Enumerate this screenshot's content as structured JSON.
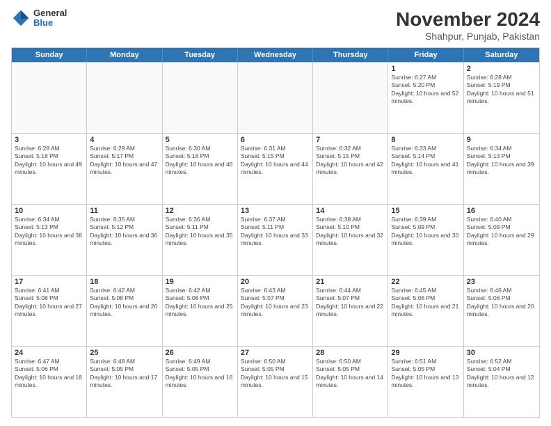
{
  "logo": {
    "general": "General",
    "blue": "Blue"
  },
  "header": {
    "month": "November 2024",
    "location": "Shahpur, Punjab, Pakistan"
  },
  "weekdays": [
    "Sunday",
    "Monday",
    "Tuesday",
    "Wednesday",
    "Thursday",
    "Friday",
    "Saturday"
  ],
  "rows": [
    [
      {
        "day": "",
        "info": ""
      },
      {
        "day": "",
        "info": ""
      },
      {
        "day": "",
        "info": ""
      },
      {
        "day": "",
        "info": ""
      },
      {
        "day": "",
        "info": ""
      },
      {
        "day": "1",
        "info": "Sunrise: 6:27 AM\nSunset: 5:20 PM\nDaylight: 10 hours and 52 minutes."
      },
      {
        "day": "2",
        "info": "Sunrise: 6:28 AM\nSunset: 5:19 PM\nDaylight: 10 hours and 51 minutes."
      }
    ],
    [
      {
        "day": "3",
        "info": "Sunrise: 6:28 AM\nSunset: 5:18 PM\nDaylight: 10 hours and 49 minutes."
      },
      {
        "day": "4",
        "info": "Sunrise: 6:29 AM\nSunset: 5:17 PM\nDaylight: 10 hours and 47 minutes."
      },
      {
        "day": "5",
        "info": "Sunrise: 6:30 AM\nSunset: 5:16 PM\nDaylight: 10 hours and 46 minutes."
      },
      {
        "day": "6",
        "info": "Sunrise: 6:31 AM\nSunset: 5:15 PM\nDaylight: 10 hours and 44 minutes."
      },
      {
        "day": "7",
        "info": "Sunrise: 6:32 AM\nSunset: 5:15 PM\nDaylight: 10 hours and 42 minutes."
      },
      {
        "day": "8",
        "info": "Sunrise: 6:33 AM\nSunset: 5:14 PM\nDaylight: 10 hours and 41 minutes."
      },
      {
        "day": "9",
        "info": "Sunrise: 6:34 AM\nSunset: 5:13 PM\nDaylight: 10 hours and 39 minutes."
      }
    ],
    [
      {
        "day": "10",
        "info": "Sunrise: 6:34 AM\nSunset: 5:13 PM\nDaylight: 10 hours and 38 minutes."
      },
      {
        "day": "11",
        "info": "Sunrise: 6:35 AM\nSunset: 5:12 PM\nDaylight: 10 hours and 36 minutes."
      },
      {
        "day": "12",
        "info": "Sunrise: 6:36 AM\nSunset: 5:11 PM\nDaylight: 10 hours and 35 minutes."
      },
      {
        "day": "13",
        "info": "Sunrise: 6:37 AM\nSunset: 5:11 PM\nDaylight: 10 hours and 33 minutes."
      },
      {
        "day": "14",
        "info": "Sunrise: 6:38 AM\nSunset: 5:10 PM\nDaylight: 10 hours and 32 minutes."
      },
      {
        "day": "15",
        "info": "Sunrise: 6:39 AM\nSunset: 5:09 PM\nDaylight: 10 hours and 30 minutes."
      },
      {
        "day": "16",
        "info": "Sunrise: 6:40 AM\nSunset: 5:09 PM\nDaylight: 10 hours and 29 minutes."
      }
    ],
    [
      {
        "day": "17",
        "info": "Sunrise: 6:41 AM\nSunset: 5:08 PM\nDaylight: 10 hours and 27 minutes."
      },
      {
        "day": "18",
        "info": "Sunrise: 6:42 AM\nSunset: 5:08 PM\nDaylight: 10 hours and 26 minutes."
      },
      {
        "day": "19",
        "info": "Sunrise: 6:42 AM\nSunset: 5:08 PM\nDaylight: 10 hours and 25 minutes."
      },
      {
        "day": "20",
        "info": "Sunrise: 6:43 AM\nSunset: 5:07 PM\nDaylight: 10 hours and 23 minutes."
      },
      {
        "day": "21",
        "info": "Sunrise: 6:44 AM\nSunset: 5:07 PM\nDaylight: 10 hours and 22 minutes."
      },
      {
        "day": "22",
        "info": "Sunrise: 6:45 AM\nSunset: 5:06 PM\nDaylight: 10 hours and 21 minutes."
      },
      {
        "day": "23",
        "info": "Sunrise: 6:46 AM\nSunset: 5:06 PM\nDaylight: 10 hours and 20 minutes."
      }
    ],
    [
      {
        "day": "24",
        "info": "Sunrise: 6:47 AM\nSunset: 5:06 PM\nDaylight: 10 hours and 18 minutes."
      },
      {
        "day": "25",
        "info": "Sunrise: 6:48 AM\nSunset: 5:05 PM\nDaylight: 10 hours and 17 minutes."
      },
      {
        "day": "26",
        "info": "Sunrise: 6:49 AM\nSunset: 5:05 PM\nDaylight: 10 hours and 16 minutes."
      },
      {
        "day": "27",
        "info": "Sunrise: 6:50 AM\nSunset: 5:05 PM\nDaylight: 10 hours and 15 minutes."
      },
      {
        "day": "28",
        "info": "Sunrise: 6:50 AM\nSunset: 5:05 PM\nDaylight: 10 hours and 14 minutes."
      },
      {
        "day": "29",
        "info": "Sunrise: 6:51 AM\nSunset: 5:05 PM\nDaylight: 10 hours and 13 minutes."
      },
      {
        "day": "30",
        "info": "Sunrise: 6:52 AM\nSunset: 5:04 PM\nDaylight: 10 hours and 12 minutes."
      }
    ]
  ]
}
